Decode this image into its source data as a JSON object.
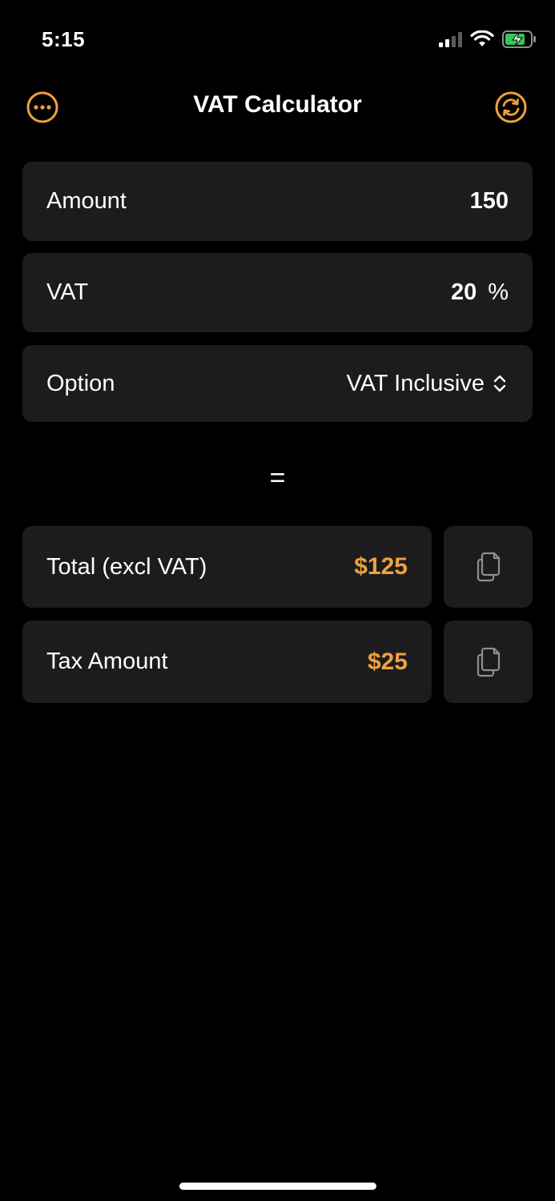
{
  "status_bar": {
    "time": "5:15"
  },
  "nav": {
    "title": "VAT Calculator",
    "left_icon": "more-icon",
    "right_icon": "refresh-icon",
    "accent_color": "#f0a13b"
  },
  "form": {
    "amount": {
      "label": "Amount",
      "value": "150"
    },
    "vat": {
      "label": "VAT",
      "value": "20",
      "unit": "%"
    },
    "option": {
      "label": "Option",
      "value": "VAT Inclusive"
    }
  },
  "equals_symbol": "=",
  "results": [
    {
      "label": "Total (excl VAT)",
      "value": "$125"
    },
    {
      "label": "Tax Amount",
      "value": "$25"
    }
  ]
}
